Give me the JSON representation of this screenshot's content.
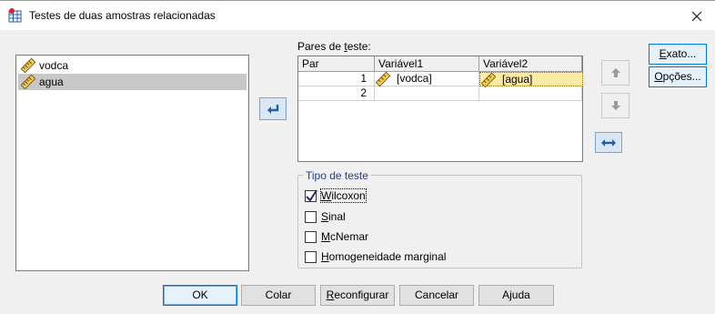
{
  "window": {
    "title": "Testes de duas amostras relacionadas"
  },
  "source_list": {
    "items": [
      {
        "label": "vodca",
        "icon": "scale-variable-icon",
        "selected": false
      },
      {
        "label": "agua",
        "icon": "scale-variable-icon",
        "selected": true
      }
    ]
  },
  "pairs": {
    "label_prefix": "Pares de ",
    "label_mnemonic": "t",
    "label_suffix": "este:",
    "columns": [
      "Par",
      "Variável1",
      "Variável2"
    ],
    "rows": [
      {
        "par": "1",
        "var1": "[vodca]",
        "var2": "[agua]"
      },
      {
        "par": "2",
        "var1": "",
        "var2": ""
      }
    ]
  },
  "test_type": {
    "title": "Tipo de teste",
    "options": [
      {
        "mnemonic": "W",
        "rest": "ilcoxon",
        "checked": true
      },
      {
        "mnemonic": "S",
        "rest": "inal",
        "checked": false
      },
      {
        "mnemonic": "M",
        "rest": "cNemar",
        "checked": false
      },
      {
        "mnemonic": "H",
        "rest": "omogeneidade marginal",
        "checked": false
      }
    ]
  },
  "side_buttons": {
    "exact": {
      "mnemonic": "E",
      "rest": "xato..."
    },
    "options": {
      "mnemonic": "O",
      "rest": "pções..."
    }
  },
  "footer": {
    "ok": "OK",
    "paste": "Colar",
    "reset": {
      "mnemonic": "R",
      "rest": "econfigurar"
    },
    "cancel": "Cancelar",
    "help": "Ajuda"
  },
  "colors": {
    "selected_row": "#fbe9a6",
    "group_title": "#1f3f8f",
    "accent": "#0078d7"
  }
}
